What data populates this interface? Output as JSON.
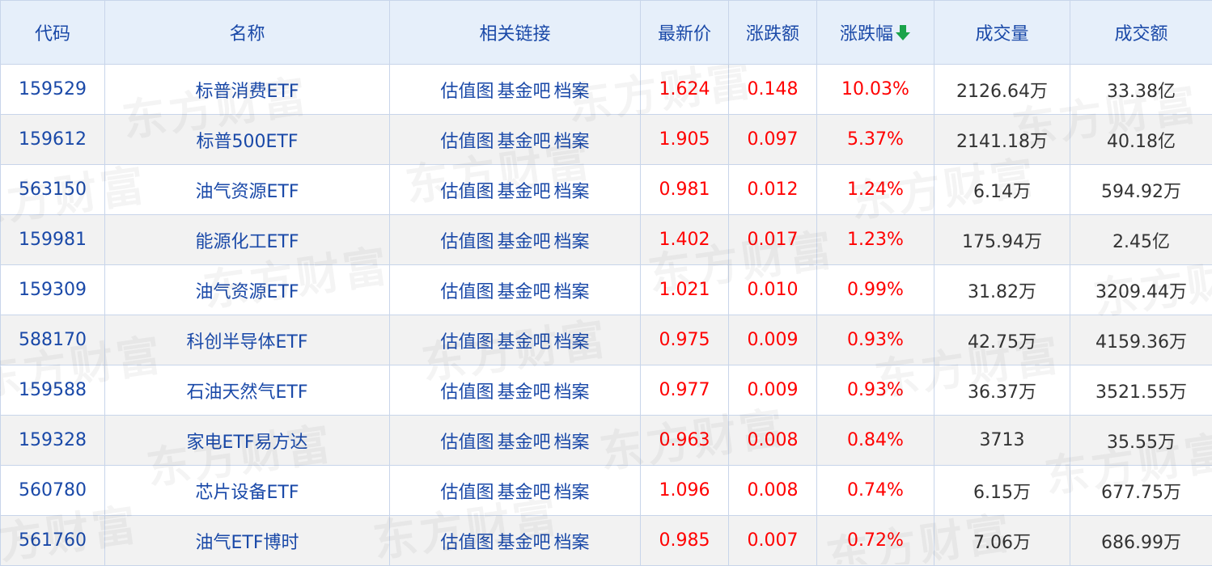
{
  "headers": {
    "code": "代码",
    "name": "名称",
    "links": "相关链接",
    "price": "最新价",
    "change": "涨跌额",
    "change_pct": "涨跌幅",
    "volume": "成交量",
    "amount": "成交额"
  },
  "sort_icon": "arrow-down-icon",
  "colors": {
    "header_text": "#1a49a8",
    "rise": "#ff0000",
    "sort_arrow": "#1aa34a"
  },
  "watermark": "东方财富",
  "rows": [
    {
      "code": "159529",
      "name": "标普消费ETF",
      "links": [
        "估值图",
        "基金吧",
        "档案"
      ],
      "price": "1.624",
      "change": "0.148",
      "change_pct": "10.03%",
      "volume": "2126.64万",
      "amount": "33.38亿"
    },
    {
      "code": "159612",
      "name": "标普500ETF",
      "links": [
        "估值图",
        "基金吧",
        "档案"
      ],
      "price": "1.905",
      "change": "0.097",
      "change_pct": "5.37%",
      "volume": "2141.18万",
      "amount": "40.18亿"
    },
    {
      "code": "563150",
      "name": "油气资源ETF",
      "links": [
        "估值图",
        "基金吧",
        "档案"
      ],
      "price": "0.981",
      "change": "0.012",
      "change_pct": "1.24%",
      "volume": "6.14万",
      "amount": "594.92万"
    },
    {
      "code": "159981",
      "name": "能源化工ETF",
      "links": [
        "估值图",
        "基金吧",
        "档案"
      ],
      "price": "1.402",
      "change": "0.017",
      "change_pct": "1.23%",
      "volume": "175.94万",
      "amount": "2.45亿"
    },
    {
      "code": "159309",
      "name": "油气资源ETF",
      "links": [
        "估值图",
        "基金吧",
        "档案"
      ],
      "price": "1.021",
      "change": "0.010",
      "change_pct": "0.99%",
      "volume": "31.82万",
      "amount": "3209.44万"
    },
    {
      "code": "588170",
      "name": "科创半导体ETF",
      "links": [
        "估值图",
        "基金吧",
        "档案"
      ],
      "price": "0.975",
      "change": "0.009",
      "change_pct": "0.93%",
      "volume": "42.75万",
      "amount": "4159.36万"
    },
    {
      "code": "159588",
      "name": "石油天然气ETF",
      "links": [
        "估值图",
        "基金吧",
        "档案"
      ],
      "price": "0.977",
      "change": "0.009",
      "change_pct": "0.93%",
      "volume": "36.37万",
      "amount": "3521.55万"
    },
    {
      "code": "159328",
      "name": "家电ETF易方达",
      "links": [
        "估值图",
        "基金吧",
        "档案"
      ],
      "price": "0.963",
      "change": "0.008",
      "change_pct": "0.84%",
      "volume": "3713",
      "amount": "35.55万"
    },
    {
      "code": "560780",
      "name": "芯片设备ETF",
      "links": [
        "估值图",
        "基金吧",
        "档案"
      ],
      "price": "1.096",
      "change": "0.008",
      "change_pct": "0.74%",
      "volume": "6.15万",
      "amount": "677.75万"
    },
    {
      "code": "561760",
      "name": "油气ETF博时",
      "links": [
        "估值图",
        "基金吧",
        "档案"
      ],
      "price": "0.985",
      "change": "0.007",
      "change_pct": "0.72%",
      "volume": "7.06万",
      "amount": "686.99万"
    }
  ]
}
